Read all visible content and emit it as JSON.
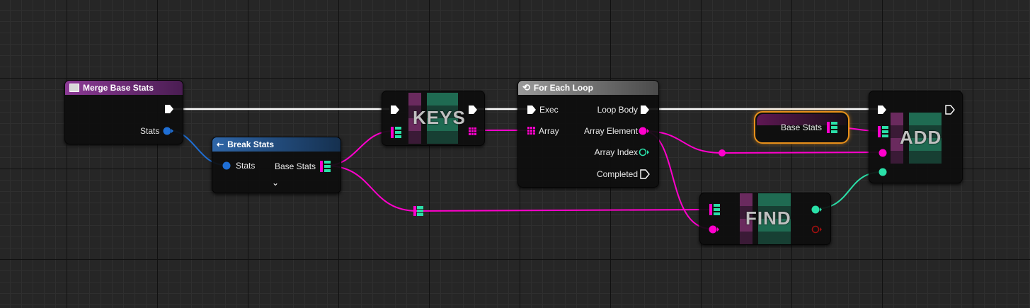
{
  "nodes": {
    "merge_base_stats": {
      "title": "Merge Base Stats",
      "pins": {
        "stats": "Stats"
      }
    },
    "break_stats": {
      "title": "Break Stats",
      "pins": {
        "stats": "Stats",
        "base_stats": "Base Stats"
      }
    },
    "keys": {
      "title": "KEYS"
    },
    "for_each_loop": {
      "title": "For Each Loop",
      "pins": {
        "exec": "Exec",
        "array": "Array",
        "loop_body": "Loop Body",
        "array_element": "Array Element",
        "array_index": "Array Index",
        "completed": "Completed"
      }
    },
    "base_stats_var": {
      "label": "Base Stats"
    },
    "add": {
      "title": "ADD"
    },
    "find": {
      "title": "FIND"
    }
  },
  "colors": {
    "function_header": "#7b2f86",
    "pure_header": "#2a5a98",
    "macro_header": "#8a8a8a",
    "exec_wire": "#ffffff",
    "struct_blue": "#1f6fd6",
    "map_magenta": "#ff00cc",
    "int_teal": "#2ae0a8",
    "bool_red": "#a01010",
    "selected_outline": "#e8901a"
  },
  "icons": {
    "function_node": "function-icon",
    "break_node": "break-struct-icon",
    "loop_node": "loop-macro-icon"
  }
}
